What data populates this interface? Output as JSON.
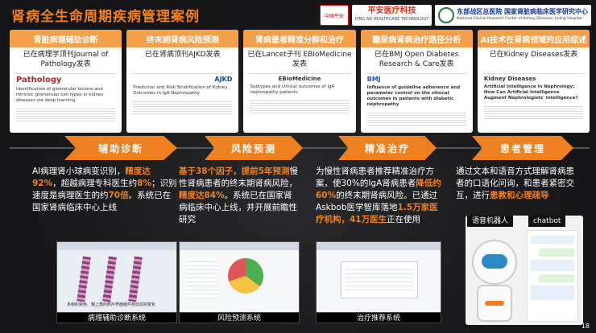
{
  "slide": {
    "title": "肾病全生命周期疾病管理案例",
    "page_number": "18"
  },
  "logos": {
    "pingan_main": "平安医疗科技",
    "pingan_sub": "PING AN HEALTHCARE TECHNOLOGY",
    "red_badge": "中国平安",
    "hospital_main": "东部战区总医院  国家肾脏病临床医学研究中心",
    "hospital_sub": "National Clinical Research Center of Kidney Diseases, Jinling Hospital"
  },
  "cards": [
    {
      "head": "肾脏病理辅助诊断",
      "sub": "已在病理学顶刊Journal of Pathology发表",
      "journal": "Pathology",
      "ptitle": "Identification of glomerular lesions and intrinsic glomerular cell types in kidney diseases via deep learning"
    },
    {
      "head": "终末期肾病风险预测",
      "sub": "已在肾病顶刊AJKD发表",
      "journal": "AJKD",
      "ptitle": "Prediction and Risk Stratification of Kidney Outcomes in IgA Nephropathy"
    },
    {
      "head": "肾病患者精准分群和治疗",
      "sub": "已在Lancet子刊 EBioMedicine发表",
      "journal": "EBioMedicine",
      "ptitle": "Subtypes and clinical outcomes of IgA nephropathy patients"
    },
    {
      "head": "糖尿病肾病治疗路径分析",
      "sub": "已在BMJ Open Diabetes Research & Care发表",
      "journal": "BMJ",
      "ptitle": "Influence of guideline adherence and parameter control on the clinical outcomes in patients with diabetic nephropathy"
    },
    {
      "head": "AI技术在肾病领域的应用综述",
      "sub": "已在Kidney Diseases发表",
      "journal": "Kidney Diseases",
      "ptitle": "Artificial Intelligence in Nephrology: How Can Artificial Intelligence Augment Nephrologists' Intelligence?"
    }
  ],
  "arrows": [
    "辅助诊断",
    "风险预测",
    "精准治疗",
    "患者管理"
  ],
  "columns": {
    "diag": {
      "p1": "AI病理肾小球病变识别，",
      "h1": "精度达92%",
      "p2": "，超越病理专科医生约",
      "h2": "8%",
      "p3": "；识别速度是病理医生的约",
      "h3": "70倍",
      "p4": "。系统已在国家肾病临床中心上线"
    },
    "risk": {
      "h1": "基于38个因子，提前5年预测",
      "p1": "慢性肾病患者的终末期肾病风险，",
      "h2": "精度达84%",
      "p2": "。系统已在国家肾病临床中心上线，并开展前瞻性研究"
    },
    "treat": {
      "p1": "为慢性肾病患者推荐精准治疗方案，使30%的IgA肾病患者",
      "h1": "降低约60%",
      "p2": "的终末期肾病风险。已通过Askbob医学智库落地",
      "h2": "1.5万家医疗机构，41万医生",
      "p3": "正在使用"
    },
    "mgmt": {
      "p1": "通过文本和语音方式理解肾病患者的口语化问询，和患者紧密交互，进行",
      "h1": "患教和心理疏导"
    }
  },
  "screens": {
    "diag_caption": "病理辅助诊断系统",
    "diag_overlay": "多组织染色、粗上角的照片界面组件自动识别变化",
    "risk_caption": "风险预测系统",
    "treat_caption": "治疗推荐系统",
    "robot_tag": "语音机器人",
    "chatbot_tag": "chatbot"
  },
  "colors": {
    "accent": "#f08020",
    "card_head": "#f4a04a",
    "arrow": "#ee8022"
  }
}
